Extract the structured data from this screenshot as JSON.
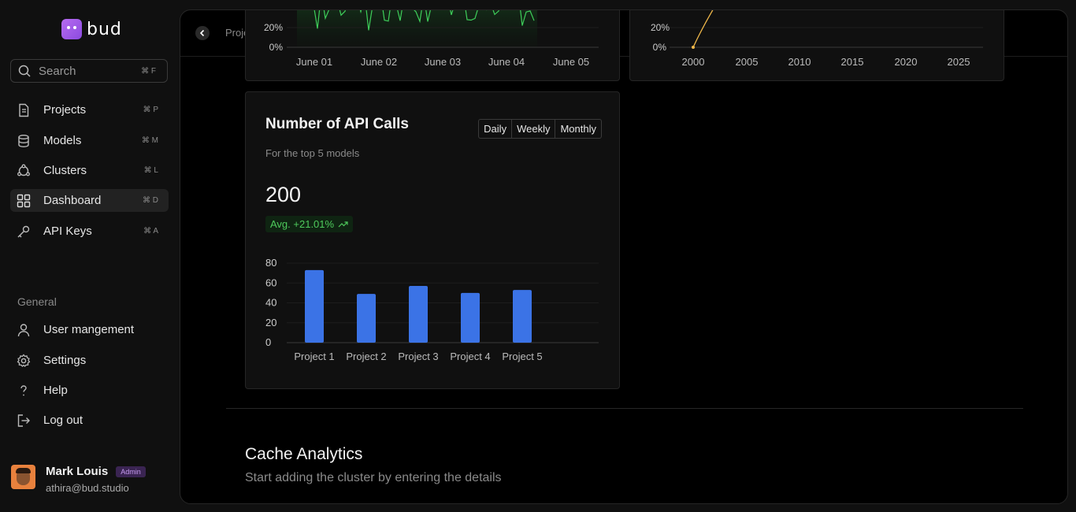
{
  "app": {
    "logo_text": "bud"
  },
  "sidebar": {
    "search": {
      "placeholder": "Search",
      "shortcut": "⌘ F"
    },
    "items": [
      {
        "label": "Projects",
        "shortcut": "⌘ P"
      },
      {
        "label": "Models",
        "shortcut": "⌘ M"
      },
      {
        "label": "Clusters",
        "shortcut": "⌘ L"
      },
      {
        "label": "Dashboard",
        "shortcut": "⌘ D"
      },
      {
        "label": "API Keys",
        "shortcut": "⌘ A"
      }
    ],
    "general_title": "General",
    "general_items": [
      {
        "label": "User mangement"
      },
      {
        "label": "Settings"
      },
      {
        "label": "Help"
      },
      {
        "label": "Log out"
      }
    ],
    "user": {
      "name": "Mark Louis",
      "role": "Admin",
      "email": "athira@bud.studio"
    }
  },
  "topbar": {
    "breadcrumb": "Proje"
  },
  "chart_top_left": {
    "y_ticks": [
      "20%",
      "0%"
    ],
    "x_ticks": [
      "June 01",
      "June 02",
      "June 03",
      "June 04",
      "June 05"
    ],
    "line_color": "#3ecf5a"
  },
  "chart_top_right": {
    "y_ticks": [
      "20%",
      "0%"
    ],
    "x_ticks": [
      "2000",
      "2005",
      "2010",
      "2015",
      "2020",
      "2025"
    ],
    "line_color": "#f0b84a"
  },
  "api_card": {
    "title": "Number of API Calls",
    "subtitle": "For the top 5 models",
    "tabs": [
      "Daily",
      "Weekly",
      "Monthly"
    ],
    "total": "200",
    "avg_label": "Avg. +21.01%",
    "bar_color": "#3b73e6"
  },
  "chart_data": {
    "type": "bar",
    "categories": [
      "Project 1",
      "Project 2",
      "Project 3",
      "Project 4",
      "Project 5"
    ],
    "values": [
      73,
      49,
      57,
      50,
      53
    ],
    "y_ticks": [
      0,
      20,
      40,
      60,
      80
    ],
    "ylim": [
      0,
      80
    ],
    "grid": true
  },
  "cache": {
    "title": "Cache Analytics",
    "subtitle": "Start adding the cluster by entering the details"
  }
}
